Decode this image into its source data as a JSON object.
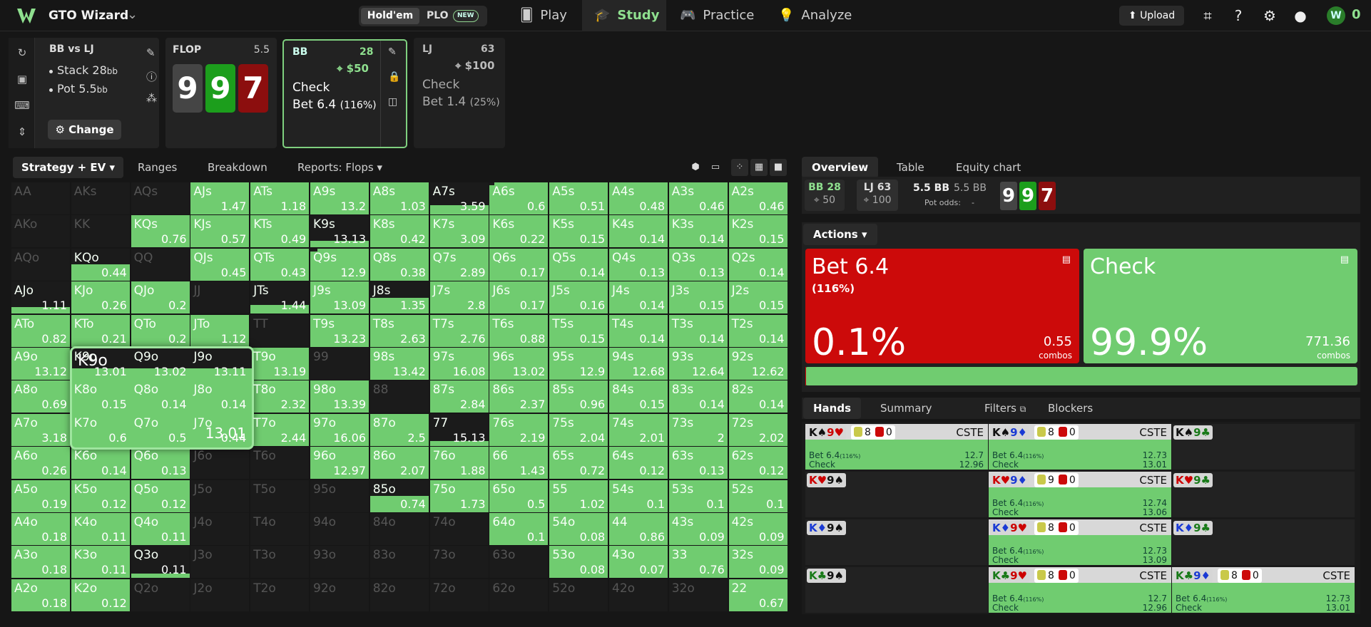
{
  "app": {
    "brand": "GTO Wizard",
    "chevron": "⌄"
  },
  "game_toggle": {
    "holdem": "Hold'em",
    "plo": "PLO",
    "new_badge": "NEW"
  },
  "nav": [
    {
      "label": "Play",
      "icon": "cards-icon"
    },
    {
      "label": "Study",
      "icon": "graduation-cap-icon"
    },
    {
      "label": "Practice",
      "icon": "gamepad-icon"
    },
    {
      "label": "Analyze",
      "icon": "lightbulb-icon"
    }
  ],
  "top_right": {
    "upload": "Upload",
    "coin_count": "0"
  },
  "scenario": {
    "title": "BB vs LJ",
    "stack": "Stack 28",
    "stack_unit": "bb",
    "pot": "Pot 5.5",
    "pot_unit": "bb",
    "change": "Change"
  },
  "flop": {
    "title": "FLOP",
    "pot": "5.5",
    "cards": [
      {
        "rank": "9",
        "color": "#454545"
      },
      {
        "rank": "9",
        "color": "#1c9e1c"
      },
      {
        "rank": "7",
        "color": "#8c0e0e"
      }
    ]
  },
  "bb_col": {
    "name": "BB",
    "stack": "28",
    "pot": "$50",
    "action1": "Check",
    "action2": "Bet 6.4",
    "action2_pct": "(116%)"
  },
  "lj_col": {
    "name": "LJ",
    "stack": "63",
    "pot": "$100",
    "action1": "Check",
    "action2": "Bet 1.4",
    "action2_pct": "(25%)"
  },
  "strategy_tabs": {
    "active": "Strategy + EV",
    "ranges": "Ranges",
    "breakdown": "Breakdown",
    "reports": "Reports: Flops"
  },
  "grid": [
    [
      [
        "AA",
        null,
        0,
        0
      ],
      [
        "AKs",
        null,
        0,
        0
      ],
      [
        "AQs",
        null,
        0,
        0
      ],
      [
        "AJs",
        "1.47",
        1,
        0
      ],
      [
        "ATs",
        "1.18",
        1,
        0
      ],
      [
        "A9s",
        "13.2",
        1,
        0
      ],
      [
        "A8s",
        "1.03",
        1,
        0
      ],
      [
        "A7s",
        "3.59",
        0.28,
        0
      ],
      [
        "A6s",
        "0.6",
        1,
        0.08
      ],
      [
        "A5s",
        "0.51",
        1,
        0
      ],
      [
        "A4s",
        "0.48",
        1,
        0
      ],
      [
        "A3s",
        "0.46",
        1,
        0
      ],
      [
        "A2s",
        "0.46",
        1,
        0
      ]
    ],
    [
      [
        "AKo",
        null,
        0,
        0
      ],
      [
        "KK",
        null,
        0,
        0
      ],
      [
        "KQs",
        "0.76",
        1,
        0
      ],
      [
        "KJs",
        "0.57",
        1,
        0
      ],
      [
        "KTs",
        "0.49",
        1,
        0
      ],
      [
        "K9s",
        "13.13",
        0.2,
        0
      ],
      [
        "K8s",
        "0.42",
        1,
        0
      ],
      [
        "K7s",
        "3.09",
        1,
        0
      ],
      [
        "K6s",
        "0.22",
        1,
        0
      ],
      [
        "K5s",
        "0.15",
        1,
        0
      ],
      [
        "K4s",
        "0.14",
        1,
        0
      ],
      [
        "K3s",
        "0.14",
        1,
        0
      ],
      [
        "K2s",
        "0.15",
        1,
        0
      ]
    ],
    [
      [
        "AQo",
        null,
        0,
        0
      ],
      [
        "KQo",
        "0.44",
        0.5,
        0
      ],
      [
        "QQ",
        null,
        0,
        0
      ],
      [
        "QJs",
        "0.45",
        1,
        0
      ],
      [
        "QTs",
        "0.43",
        1,
        0
      ],
      [
        "Q9s",
        "12.9",
        1,
        0.12
      ],
      [
        "Q8s",
        "0.38",
        1,
        0
      ],
      [
        "Q7s",
        "2.89",
        1,
        0
      ],
      [
        "Q6s",
        "0.17",
        1,
        0
      ],
      [
        "Q5s",
        "0.14",
        1,
        0
      ],
      [
        "Q4s",
        "0.13",
        1,
        0
      ],
      [
        "Q3s",
        "0.13",
        1,
        0
      ],
      [
        "Q2s",
        "0.14",
        1,
        0
      ]
    ],
    [
      [
        "AJo",
        "1.11",
        0.2,
        0
      ],
      [
        "KJo",
        "0.26",
        1,
        0
      ],
      [
        "QJo",
        "0.2",
        1,
        0
      ],
      [
        "JJ",
        null,
        0,
        0
      ],
      [
        "JTs",
        "1.44",
        0.28,
        0
      ],
      [
        "J9s",
        "13.09",
        1,
        0
      ],
      [
        "J8s",
        "1.35",
        0.5,
        0
      ],
      [
        "J7s",
        "2.8",
        1,
        0
      ],
      [
        "J6s",
        "0.17",
        1,
        0
      ],
      [
        "J5s",
        "0.16",
        1,
        0
      ],
      [
        "J4s",
        "0.14",
        1,
        0
      ],
      [
        "J3s",
        "0.15",
        1,
        0
      ],
      [
        "J2s",
        "0.15",
        1,
        0
      ]
    ],
    [
      [
        "ATo",
        "0.82",
        1,
        0
      ],
      [
        "KTo",
        "0.21",
        1,
        0
      ],
      [
        "QTo",
        "0.2",
        1,
        0
      ],
      [
        "JTo",
        "1.12",
        1,
        0
      ],
      [
        "TT",
        null,
        0,
        0
      ],
      [
        "T9s",
        "13.23",
        1,
        0
      ],
      [
        "T8s",
        "2.63",
        1,
        0
      ],
      [
        "T7s",
        "2.76",
        1,
        0
      ],
      [
        "T6s",
        "0.88",
        1,
        0
      ],
      [
        "T5s",
        "0.15",
        1,
        0
      ],
      [
        "T4s",
        "0.14",
        1,
        0
      ],
      [
        "T3s",
        "0.14",
        1,
        0
      ],
      [
        "T2s",
        "0.14",
        1,
        0
      ]
    ],
    [
      [
        "A9o",
        "13.12",
        1,
        0
      ],
      [
        "K9o",
        "13.01",
        1,
        0
      ],
      [
        "Q9o",
        "13.02",
        1,
        0
      ],
      [
        "J9o",
        "13.11",
        1,
        0
      ],
      [
        "T9o",
        "13.19",
        1,
        0
      ],
      [
        "99",
        null,
        0,
        0
      ],
      [
        "98s",
        "13.42",
        1,
        0
      ],
      [
        "97s",
        "16.08",
        1,
        0
      ],
      [
        "96s",
        "13.02",
        1,
        0
      ],
      [
        "95s",
        "12.9",
        1,
        0
      ],
      [
        "94s",
        "12.68",
        1,
        0
      ],
      [
        "93s",
        "12.64",
        1,
        0
      ],
      [
        "92s",
        "12.62",
        1,
        0
      ]
    ],
    [
      [
        "A8o",
        "0.69",
        1,
        0
      ],
      [
        "K8o",
        "0.15",
        1,
        0
      ],
      [
        "Q8o",
        "0.14",
        1,
        0
      ],
      [
        "J8o",
        "0.14",
        1,
        0
      ],
      [
        "T8o",
        "2.32",
        1,
        0
      ],
      [
        "98o",
        "13.39",
        1,
        0
      ],
      [
        "88",
        null,
        0,
        0
      ],
      [
        "87s",
        "2.84",
        1,
        0
      ],
      [
        "86s",
        "2.37",
        1,
        0
      ],
      [
        "85s",
        "0.96",
        1,
        0
      ],
      [
        "84s",
        "0.15",
        1,
        0
      ],
      [
        "83s",
        "0.14",
        1,
        0
      ],
      [
        "82s",
        "0.14",
        1,
        0
      ]
    ],
    [
      [
        "A7o",
        "3.18",
        1,
        0
      ],
      [
        "K7o",
        "0.6",
        1,
        0
      ],
      [
        "Q7o",
        "0.5",
        1,
        0
      ],
      [
        "J7o",
        "0.44",
        1,
        0
      ],
      [
        "T7o",
        "2.44",
        1,
        0
      ],
      [
        "97o",
        "16.06",
        1,
        0
      ],
      [
        "87o",
        "2.5",
        1,
        0
      ],
      [
        "77",
        "15.13",
        0.16,
        0
      ],
      [
        "76s",
        "2.19",
        1,
        0
      ],
      [
        "75s",
        "2.04",
        1,
        0
      ],
      [
        "74s",
        "2.01",
        1,
        0
      ],
      [
        "73s",
        "2",
        1,
        0
      ],
      [
        "72s",
        "2.02",
        1,
        0
      ]
    ],
    [
      [
        "A6o",
        "0.26",
        1,
        0
      ],
      [
        "K6o",
        "0.14",
        1,
        0
      ],
      [
        "Q6o",
        "0.13",
        1,
        0
      ],
      [
        "J6o",
        null,
        0,
        0
      ],
      [
        "T6o",
        null,
        0,
        0
      ],
      [
        "96o",
        "12.97",
        1,
        0
      ],
      [
        "86o",
        "2.07",
        1,
        0
      ],
      [
        "76o",
        "1.88",
        1,
        0
      ],
      [
        "66",
        "1.43",
        1,
        0
      ],
      [
        "65s",
        "0.72",
        1,
        0
      ],
      [
        "64s",
        "0.12",
        1,
        0
      ],
      [
        "63s",
        "0.13",
        1,
        0
      ],
      [
        "62s",
        "0.12",
        1,
        0
      ]
    ],
    [
      [
        "A5o",
        "0.19",
        1,
        0
      ],
      [
        "K5o",
        "0.12",
        1,
        0
      ],
      [
        "Q5o",
        "0.12",
        1,
        0
      ],
      [
        "J5o",
        null,
        0,
        0
      ],
      [
        "T5o",
        null,
        0,
        0
      ],
      [
        "95o",
        null,
        0,
        0
      ],
      [
        "85o",
        "0.74",
        0.5,
        0
      ],
      [
        "75o",
        "1.73",
        1,
        0
      ],
      [
        "65o",
        "0.5",
        1,
        0
      ],
      [
        "55",
        "1.02",
        1,
        0
      ],
      [
        "54s",
        "0.1",
        1,
        0
      ],
      [
        "53s",
        "0.1",
        1,
        0
      ],
      [
        "52s",
        "0.1",
        1,
        0
      ]
    ],
    [
      [
        "A4o",
        "0.18",
        1,
        0
      ],
      [
        "K4o",
        "0.11",
        1,
        0
      ],
      [
        "Q4o",
        "0.11",
        1,
        0
      ],
      [
        "J4o",
        null,
        0,
        0
      ],
      [
        "T4o",
        null,
        0,
        0
      ],
      [
        "94o",
        null,
        0,
        0
      ],
      [
        "84o",
        null,
        0,
        0
      ],
      [
        "74o",
        null,
        0,
        0
      ],
      [
        "64o",
        "0.1",
        1,
        0
      ],
      [
        "54o",
        "0.08",
        1,
        0
      ],
      [
        "44",
        "0.86",
        1,
        0
      ],
      [
        "43s",
        "0.09",
        1,
        0
      ],
      [
        "42s",
        "0.09",
        1,
        0
      ]
    ],
    [
      [
        "A3o",
        "0.18",
        1,
        0
      ],
      [
        "K3o",
        "0.11",
        1,
        0
      ],
      [
        "Q3o",
        "0.11",
        0.15,
        0
      ],
      [
        "J3o",
        null,
        0,
        0
      ],
      [
        "T3o",
        null,
        0,
        0
      ],
      [
        "93o",
        null,
        0,
        0
      ],
      [
        "83o",
        null,
        0,
        0
      ],
      [
        "73o",
        null,
        0,
        0
      ],
      [
        "63o",
        null,
        0,
        0
      ],
      [
        "53o",
        "0.08",
        1,
        0
      ],
      [
        "43o",
        "0.07",
        1,
        0
      ],
      [
        "33",
        "0.76",
        1,
        0
      ],
      [
        "32s",
        "0.09",
        1,
        0
      ]
    ],
    [
      [
        "A2o",
        "0.18",
        1,
        0
      ],
      [
        "K2o",
        "0.12",
        1,
        0
      ],
      [
        "Q2o",
        null,
        0,
        0
      ],
      [
        "J2o",
        null,
        0,
        0
      ],
      [
        "T2o",
        null,
        0,
        0
      ],
      [
        "92o",
        null,
        0,
        0
      ],
      [
        "82o",
        null,
        0,
        0
      ],
      [
        "72o",
        null,
        0,
        0
      ],
      [
        "62o",
        null,
        0,
        0
      ],
      [
        "52o",
        null,
        0,
        0
      ],
      [
        "42o",
        null,
        0,
        0
      ],
      [
        "32o",
        null,
        0,
        0
      ],
      [
        "22",
        "0.67",
        1,
        0
      ]
    ]
  ],
  "tooltip": {
    "hand": "K9o",
    "value": "13.01"
  },
  "right_tabs": {
    "overview": "Overview",
    "table": "Table",
    "equity": "Equity chart"
  },
  "info": {
    "bb": {
      "name": "BB 28",
      "val": "50"
    },
    "lj": {
      "name": "LJ 63",
      "val": "100"
    },
    "pot": "5.5 BB",
    "pot2": "5.5 BB",
    "pot_odds_label": "Pot odds:",
    "pot_odds_value": "-"
  },
  "actions": {
    "tab": "Actions",
    "bet": {
      "name": "Bet 6.4",
      "sub": "(116%)",
      "pct": "0.1%",
      "combos": "0.55",
      "combos_label": "combos",
      "freq": 0.001
    },
    "check": {
      "name": "Check",
      "pct": "99.9%",
      "combos": "771.36",
      "combos_label": "combos"
    }
  },
  "hand_tabs": {
    "hands": "Hands",
    "summary": "Summary",
    "filters": "Filters",
    "blockers": "Blockers"
  },
  "hands": [
    {
      "combo": [
        [
          "K",
          "k"
        ],
        [
          "♠",
          "k"
        ],
        [
          "9",
          "r"
        ],
        [
          "♥",
          "r"
        ]
      ],
      "blk": [
        "8",
        "0"
      ],
      "cste": "CSTE",
      "bet": "Bet 6.4",
      "betv": "12.7",
      "checkv": "12.96",
      "green": true
    },
    {
      "combo": [
        [
          "K",
          "k"
        ],
        [
          "♠",
          "k"
        ],
        [
          "9",
          "b"
        ],
        [
          "♦",
          "b"
        ]
      ],
      "blk": [
        "8",
        "0"
      ],
      "cste": "CSTE",
      "bet": "Bet 6.4",
      "betv": "12.73",
      "checkv": "13.01",
      "green": true
    },
    {
      "combo": [
        [
          "K",
          "k"
        ],
        [
          "♠",
          "k"
        ],
        [
          "9",
          "gr"
        ],
        [
          "♣",
          "gr"
        ]
      ],
      "empty": true
    },
    {
      "combo": [
        [
          "K",
          "r"
        ],
        [
          "♥",
          "r"
        ],
        [
          "9",
          "k"
        ],
        [
          "♠",
          "k"
        ]
      ],
      "empty": true
    },
    {
      "combo": [
        [
          "K",
          "r"
        ],
        [
          "♥",
          "r"
        ],
        [
          "9",
          "b"
        ],
        [
          "♦",
          "b"
        ]
      ],
      "blk": [
        "9",
        "0"
      ],
      "cste": "CSTE",
      "bet": "Bet 6.4",
      "betv": "12.74",
      "checkv": "13.06",
      "green": true
    },
    {
      "combo": [
        [
          "K",
          "r"
        ],
        [
          "♥",
          "r"
        ],
        [
          "9",
          "gr"
        ],
        [
          "♣",
          "gr"
        ]
      ],
      "empty": true
    },
    {
      "combo": [
        [
          "K",
          "b"
        ],
        [
          "♦",
          "b"
        ],
        [
          "9",
          "k"
        ],
        [
          "♠",
          "k"
        ]
      ],
      "empty": true
    },
    {
      "combo": [
        [
          "K",
          "b"
        ],
        [
          "♦",
          "b"
        ],
        [
          "9",
          "r"
        ],
        [
          "♥",
          "r"
        ]
      ],
      "blk": [
        "8",
        "0"
      ],
      "cste": "CSTE",
      "bet": "Bet 6.4",
      "betv": "12.73",
      "checkv": "13.09",
      "green": true
    },
    {
      "combo": [
        [
          "K",
          "b"
        ],
        [
          "♦",
          "b"
        ],
        [
          "9",
          "gr"
        ],
        [
          "♣",
          "gr"
        ]
      ],
      "empty": true
    },
    {
      "combo": [
        [
          "K",
          "gr"
        ],
        [
          "♣",
          "gr"
        ],
        [
          "9",
          "k"
        ],
        [
          "♠",
          "k"
        ]
      ],
      "empty": true
    },
    {
      "combo": [
        [
          "K",
          "gr"
        ],
        [
          "♣",
          "gr"
        ],
        [
          "9",
          "r"
        ],
        [
          "♥",
          "r"
        ]
      ],
      "blk": [
        "8",
        "0"
      ],
      "cste": "CSTE",
      "bet": "Bet 6.4",
      "betv": "12.7",
      "checkv": "12.96",
      "green": true
    },
    {
      "combo": [
        [
          "K",
          "gr"
        ],
        [
          "♣",
          "gr"
        ],
        [
          "9",
          "b"
        ],
        [
          "♦",
          "b"
        ]
      ],
      "blk": [
        "8",
        "0"
      ],
      "cste": "CSTE",
      "bet": "Bet 6.4",
      "betv": "12.73",
      "checkv": "13.01",
      "green": true
    }
  ],
  "hand_row_labels": {
    "bet_pct": "(116%)",
    "check": "Check"
  },
  "colors": {
    "green": "#70cc70",
    "red": "#cc0a0a",
    "accent": "#8fe08f"
  }
}
